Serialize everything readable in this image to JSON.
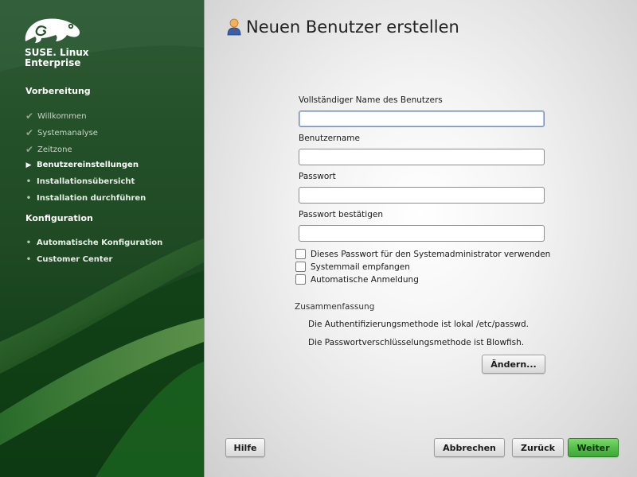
{
  "sidebar": {
    "brand_line1": "SUSE. Linux",
    "brand_line2": "Enterprise",
    "sections": [
      {
        "title": "Vorbereitung",
        "items": [
          {
            "label": "Willkommen",
            "state": "done"
          },
          {
            "label": "Systemanalyse",
            "state": "done"
          },
          {
            "label": "Zeitzone",
            "state": "done"
          },
          {
            "label": "Benutzereinstellungen",
            "state": "current"
          },
          {
            "label": "Installationsübersicht",
            "state": "pending"
          },
          {
            "label": "Installation durchführen",
            "state": "pending"
          }
        ]
      },
      {
        "title": "Konfiguration",
        "items": [
          {
            "label": "Automatische Konfiguration",
            "state": "pending"
          },
          {
            "label": "Customer Center",
            "state": "pending"
          }
        ]
      }
    ]
  },
  "main": {
    "title": "Neuen Benutzer erstellen",
    "fields": [
      {
        "label": "Vollständiger Name des Benutzers",
        "value": "",
        "placeholder": ""
      },
      {
        "label": "Benutzername",
        "value": "",
        "placeholder": ""
      },
      {
        "label": "Passwort",
        "value": "",
        "placeholder": ""
      },
      {
        "label": "Passwort bestätigen",
        "value": "",
        "placeholder": ""
      }
    ],
    "checkboxes": [
      {
        "label": "Dieses Passwort für den Systemadministrator verwenden",
        "checked": false
      },
      {
        "label": "Systemmail empfangen",
        "checked": false
      },
      {
        "label": "Automatische Anmeldung",
        "checked": false
      }
    ],
    "summary": {
      "title": "Zusammenfassung",
      "lines": [
        "Die Authentifizierungsmethode ist lokal /etc/passwd.",
        "Die Passwortverschlüsselungsmethode ist Blowfish."
      ],
      "change_button": "Ändern..."
    }
  },
  "footer": {
    "help": "Hilfe",
    "cancel": "Abbrechen",
    "back": "Zurück",
    "next": "Weiter"
  },
  "colors": {
    "sidebar_green": "#245029",
    "accent_green": "#55c048"
  }
}
